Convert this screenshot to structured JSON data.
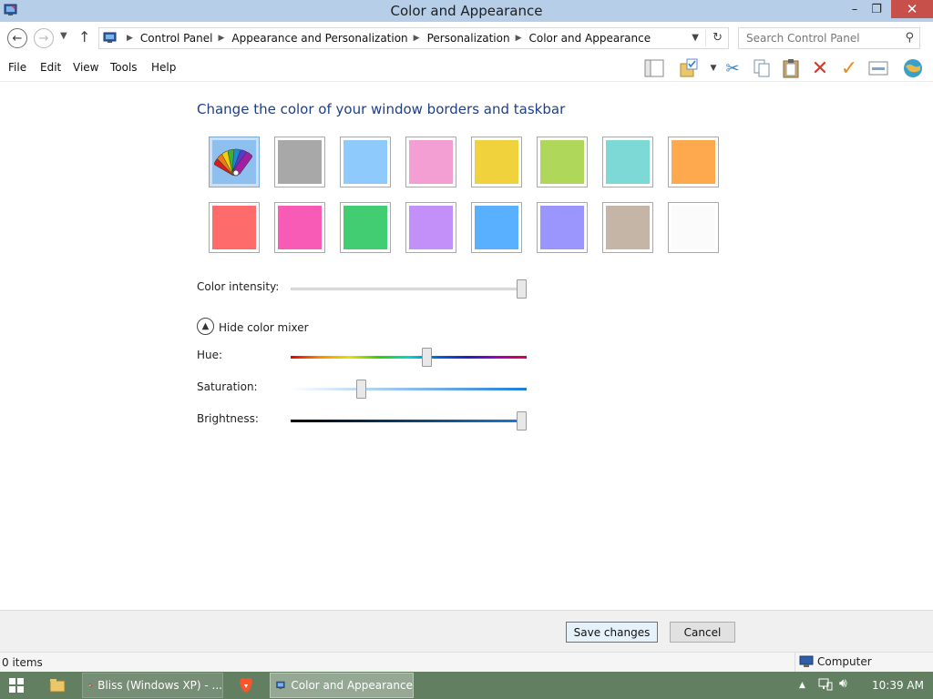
{
  "window": {
    "title": "Color and Appearance",
    "min_glyph": "–",
    "max_glyph": "❐",
    "close_glyph": "✕"
  },
  "address": {
    "crumbs": [
      "Control Panel",
      "Appearance and Personalization",
      "Personalization",
      "Color and Appearance"
    ],
    "search_placeholder": "Search Control Panel"
  },
  "menu": {
    "items": [
      "File",
      "Edit",
      "View",
      "Tools",
      "Help"
    ]
  },
  "toolbar": {
    "icons": [
      "layout-pane-icon",
      "folder-check-icon",
      "cut-icon",
      "copy-icon",
      "paste-icon",
      "delete-icon",
      "checkmark-icon",
      "properties-icon",
      "globe-icon"
    ]
  },
  "main": {
    "heading": "Change the color of your window borders and taskbar",
    "colors": [
      {
        "name": "automatic",
        "hex": "#6fa8dc"
      },
      {
        "name": "gray",
        "hex": "#a8a8a8"
      },
      {
        "name": "sky",
        "hex": "#8ecafb"
      },
      {
        "name": "pink",
        "hex": "#f39fd4"
      },
      {
        "name": "yellow",
        "hex": "#f0d23c"
      },
      {
        "name": "lime",
        "hex": "#afd85a"
      },
      {
        "name": "teal",
        "hex": "#7dd9d5"
      },
      {
        "name": "orange",
        "hex": "#fea94e"
      },
      {
        "name": "red",
        "hex": "#fe6b6b"
      },
      {
        "name": "magenta",
        "hex": "#f75bb5"
      },
      {
        "name": "green",
        "hex": "#42cd73"
      },
      {
        "name": "violet",
        "hex": "#c390fa"
      },
      {
        "name": "blue",
        "hex": "#58b0fe"
      },
      {
        "name": "periwinkle",
        "hex": "#9a96fd"
      },
      {
        "name": "taupe",
        "hex": "#c4b5a6"
      },
      {
        "name": "white",
        "hex": "#fbfbfb"
      }
    ],
    "selected_index": 0,
    "intensity_label": "Color intensity:",
    "intensity_value": 1.0,
    "mixer_toggle_label": "Hide color mixer",
    "hue_label": "Hue:",
    "hue_value": 0.58,
    "saturation_label": "Saturation:",
    "saturation_value": 0.29,
    "brightness_label": "Brightness:",
    "brightness_value": 1.0
  },
  "buttons": {
    "save": "Save changes",
    "cancel": "Cancel"
  },
  "status": {
    "items": "0 items",
    "location": "Computer"
  },
  "taskbar": {
    "tasks": [
      "Bliss (Windows XP) - ...",
      "Color and Appearance"
    ],
    "clock": "10:39 AM"
  }
}
